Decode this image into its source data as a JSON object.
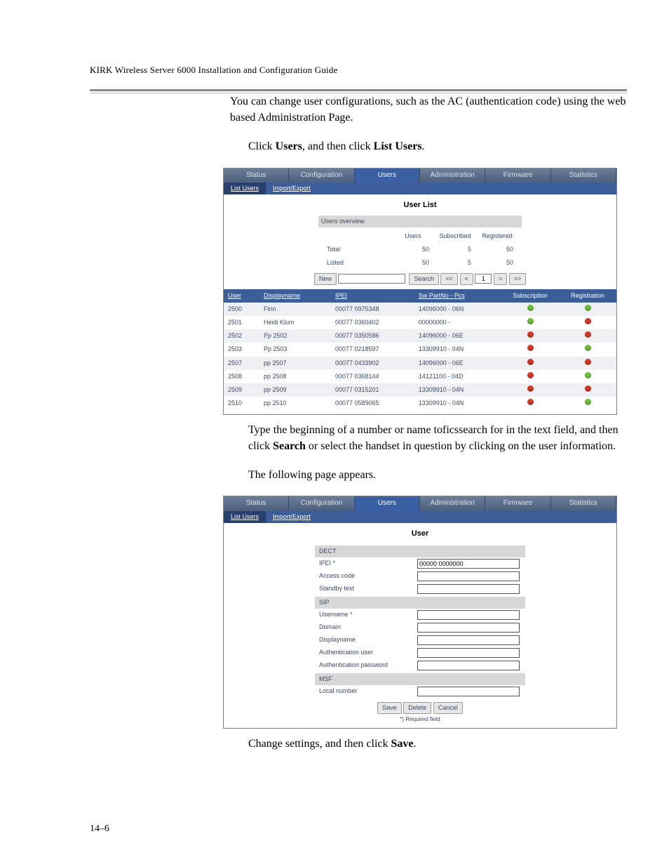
{
  "doc": {
    "header": "KIRK Wireless Server 6000 Installation and Configuration Guide",
    "p1": "You can change user configurations, such as the AC (authentication code) using the web based Administration Page.",
    "p2": {
      "a": "Click ",
      "b": "Users",
      "c": ", and then click ",
      "d": "List Users",
      "e": "."
    },
    "p3": {
      "a": "Type the beginning of a number or name toficssearch for in the text field, and then click ",
      "b": "Search",
      "c": " or select the handset in question by clicking on the user information."
    },
    "p4": "The following page appears.",
    "p5": {
      "a": "Change settings, and then click ",
      "b": "Save",
      "c": "."
    },
    "pagenum": "14–6"
  },
  "fig1": {
    "tabs": [
      "Status",
      "Configuration",
      "Users",
      "Administration",
      "Firmware",
      "Statistics"
    ],
    "subtabs": [
      "List Users",
      "Import/Export"
    ],
    "title": "User List",
    "overview": {
      "header": "Users overview",
      "cols": [
        "Users",
        "Subscribed",
        "Registered"
      ],
      "rows": [
        {
          "label": "Total",
          "users": "50",
          "sub": "5",
          "reg": "50"
        },
        {
          "label": "Listed",
          "users": "50",
          "sub": "5",
          "reg": "50"
        }
      ]
    },
    "controls": {
      "new": "New",
      "search": "Search",
      "first": "<<",
      "prev": "<",
      "page": "1",
      "next": ">",
      "last": ">>"
    },
    "table": {
      "headers": [
        "User",
        "Displayname",
        "IPEI",
        "Sw PartNo - Pcs",
        "Subscription",
        "Registration"
      ],
      "rows": [
        {
          "user": "2500",
          "name": "Finn",
          "ipei": "00077 0975348",
          "sw": "14096000 - 06N"
        },
        {
          "user": "2501",
          "name": "Heidi Klum",
          "ipei": "00077 0360402",
          "sw": "00000000 -"
        },
        {
          "user": "2502",
          "name": "Pp 2502",
          "ipei": "00077 0350586",
          "sw": "14096000 - 06E"
        },
        {
          "user": "2503",
          "name": "Pp 2503",
          "ipei": "00077 0218597",
          "sw": "13309910 - 04N"
        },
        {
          "user": "2507",
          "name": "pp 2507",
          "ipei": "00077 0433902",
          "sw": "14096000 - 06E"
        },
        {
          "user": "2508",
          "name": "pp 2508",
          "ipei": "00077 0368144",
          "sw": "14121100 - 04D"
        },
        {
          "user": "2509",
          "name": "pp 2509",
          "ipei": "00077 0315201",
          "sw": "13309910 - 04N"
        },
        {
          "user": "2510",
          "name": "pp 2510",
          "ipei": "00077 0589065",
          "sw": "13309910 - 04N"
        }
      ]
    }
  },
  "fig2": {
    "title": "User",
    "sections": [
      "DECT",
      "SIP",
      "MSF"
    ],
    "fields": [
      {
        "label": "IPEI *",
        "value": "00000 0000000"
      },
      {
        "label": "Access code"
      },
      {
        "label": "Standby text"
      },
      {
        "label": "Username *"
      },
      {
        "label": "Domain"
      },
      {
        "label": "Displayname"
      },
      {
        "label": "Authentication user"
      },
      {
        "label": "Authentication password"
      },
      {
        "label": "Local number"
      }
    ],
    "buttons": [
      "Save",
      "Delete",
      "Cancel"
    ],
    "note": "*) Required field"
  }
}
